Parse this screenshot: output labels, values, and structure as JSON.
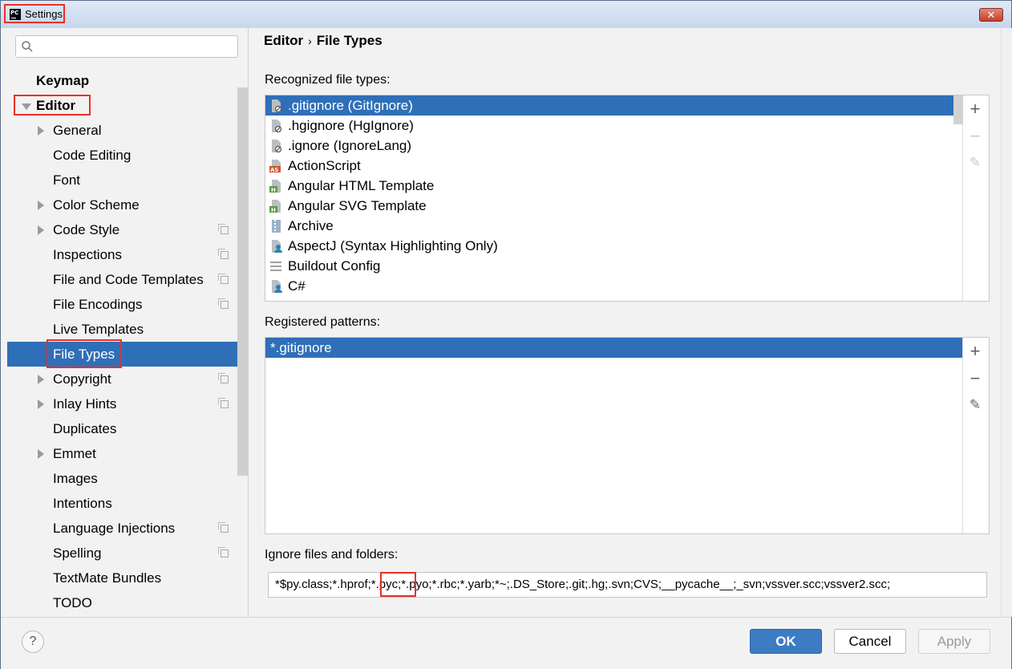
{
  "window": {
    "title": "Settings",
    "app_icon": "PC"
  },
  "search": {
    "placeholder": ""
  },
  "tree": {
    "keymap": "Keymap",
    "editor": "Editor",
    "items": [
      {
        "label": "General",
        "expandable": true,
        "project": false
      },
      {
        "label": "Code Editing",
        "expandable": false,
        "project": false
      },
      {
        "label": "Font",
        "expandable": false,
        "project": false
      },
      {
        "label": "Color Scheme",
        "expandable": true,
        "project": false
      },
      {
        "label": "Code Style",
        "expandable": true,
        "project": true
      },
      {
        "label": "Inspections",
        "expandable": false,
        "project": true
      },
      {
        "label": "File and Code Templates",
        "expandable": false,
        "project": true
      },
      {
        "label": "File Encodings",
        "expandable": false,
        "project": true
      },
      {
        "label": "Live Templates",
        "expandable": false,
        "project": false
      },
      {
        "label": "File Types",
        "expandable": false,
        "project": false,
        "selected": true
      },
      {
        "label": "Copyright",
        "expandable": true,
        "project": true
      },
      {
        "label": "Inlay Hints",
        "expandable": true,
        "project": true
      },
      {
        "label": "Duplicates",
        "expandable": false,
        "project": false
      },
      {
        "label": "Emmet",
        "expandable": true,
        "project": false
      },
      {
        "label": "Images",
        "expandable": false,
        "project": false
      },
      {
        "label": "Intentions",
        "expandable": false,
        "project": false
      },
      {
        "label": "Language Injections",
        "expandable": false,
        "project": true
      },
      {
        "label": "Spelling",
        "expandable": false,
        "project": true
      },
      {
        "label": "TextMate Bundles",
        "expandable": false,
        "project": false
      },
      {
        "label": "TODO",
        "expandable": false,
        "project": false
      }
    ]
  },
  "breadcrumb": {
    "parent": "Editor",
    "separator": "›",
    "current": "File Types"
  },
  "recognized": {
    "label": "Recognized file types:",
    "items": [
      {
        "label": ".gitignore (GitIgnore)",
        "icon": "ignore-file-icon",
        "selected": true
      },
      {
        "label": ".hgignore (HgIgnore)",
        "icon": "ignore-file-icon"
      },
      {
        "label": ".ignore (IgnoreLang)",
        "icon": "ignore-file-icon"
      },
      {
        "label": "ActionScript",
        "icon": "actionscript-icon"
      },
      {
        "label": "Angular HTML Template",
        "icon": "html-template-icon"
      },
      {
        "label": "Angular SVG Template",
        "icon": "html-template-icon"
      },
      {
        "label": "Archive",
        "icon": "archive-icon"
      },
      {
        "label": "AspectJ (Syntax Highlighting Only)",
        "icon": "aspectj-icon"
      },
      {
        "label": "Buildout Config",
        "icon": "config-icon"
      },
      {
        "label": "C#",
        "icon": "csharp-icon"
      }
    ]
  },
  "patterns": {
    "label": "Registered patterns:",
    "items": [
      {
        "label": "*.gitignore",
        "selected": true
      }
    ]
  },
  "tools": {
    "add": "+",
    "remove": "−",
    "edit": "✎"
  },
  "ignore": {
    "label": "Ignore files and folders:",
    "value": "*$py.class;*.hprof;*.pyc;*.pyo;*.rbc;*.yarb;*~;.DS_Store;.git;.hg;.svn;CVS;__pycache__;_svn;vssver.scc;vssver2.scc;"
  },
  "buttons": {
    "help": "?",
    "ok": "OK",
    "cancel": "Cancel",
    "apply": "Apply"
  },
  "colors": {
    "selection": "#2f6fb7",
    "highlight": "#e8302a",
    "ok_button": "#3c7cc3"
  }
}
